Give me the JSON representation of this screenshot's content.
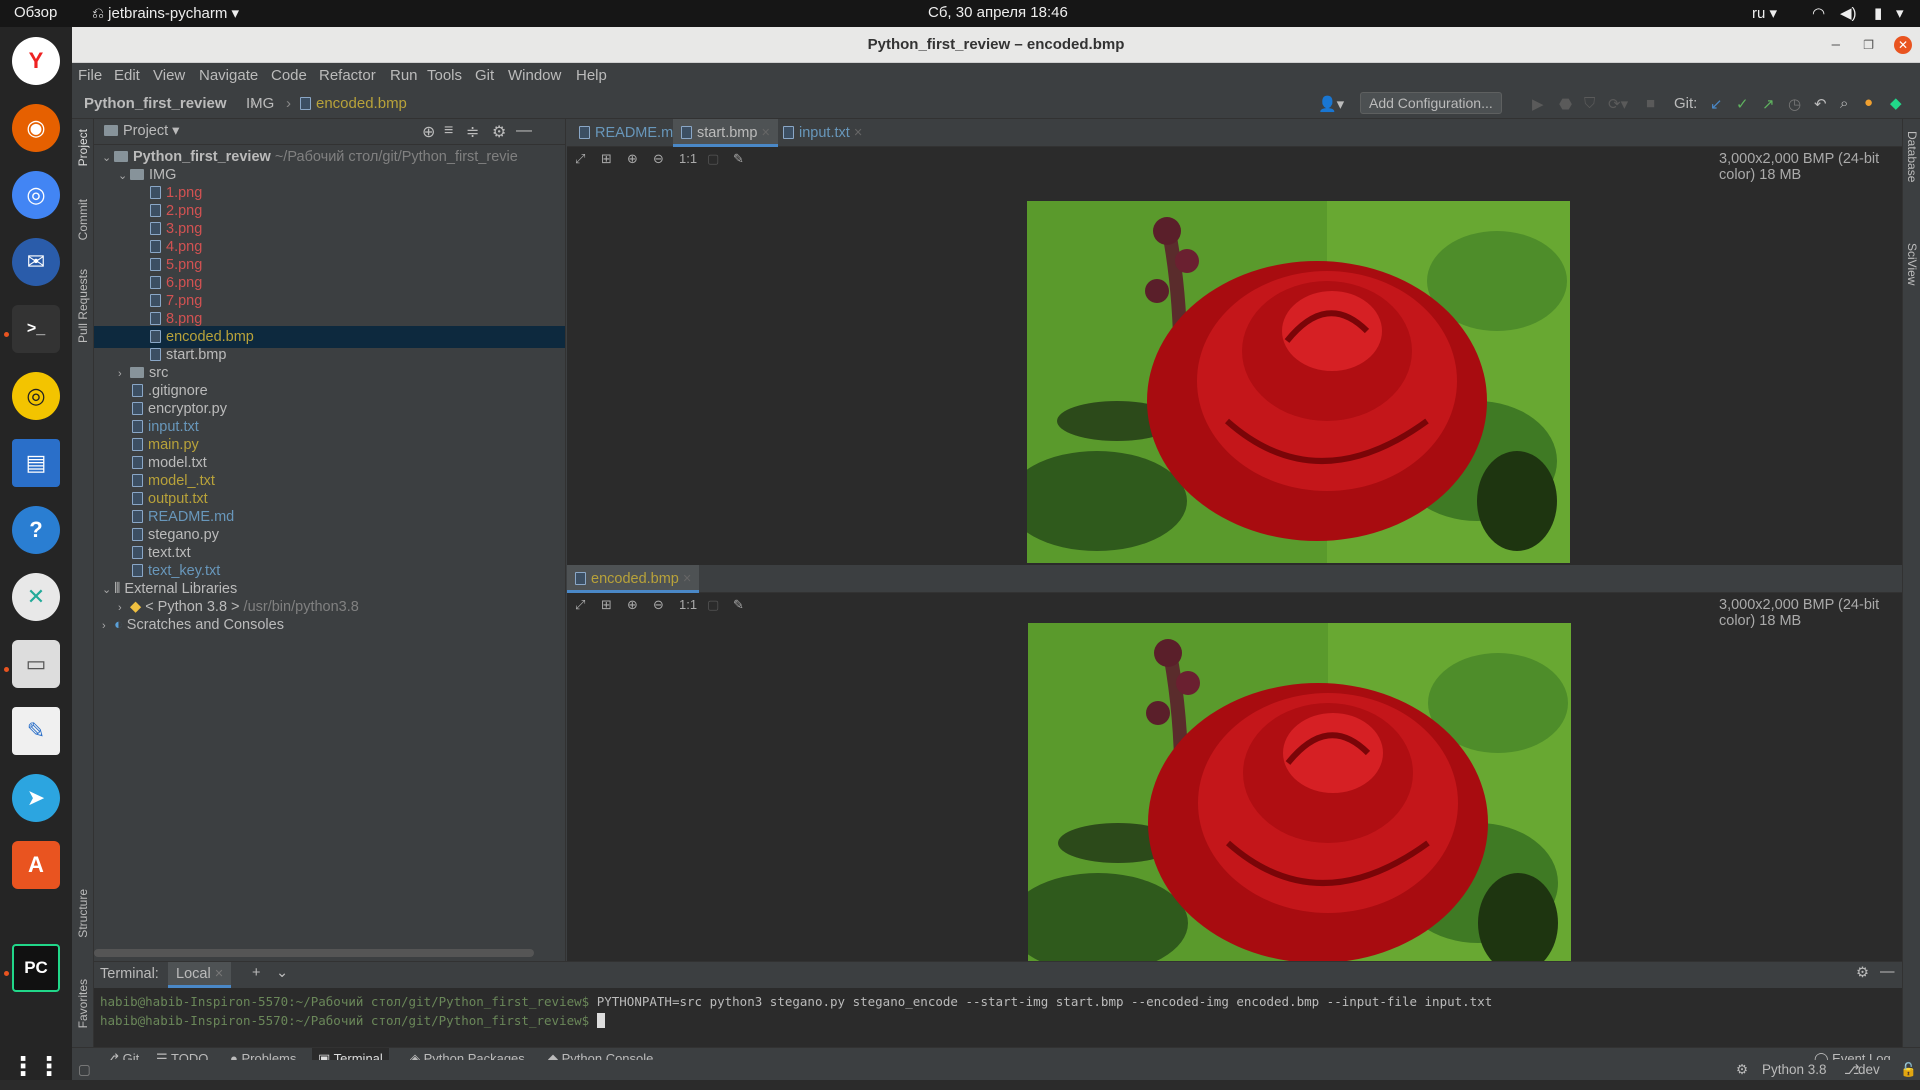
{
  "system": {
    "overview": "Обзор",
    "app_menu": "jetbrains-pycharm ▾",
    "datetime": "Сб, 30 апреля  18:46",
    "lang": "ru ▾"
  },
  "window": {
    "title": "Python_first_review – encoded.bmp"
  },
  "menu": [
    "File",
    "Edit",
    "View",
    "Navigate",
    "Code",
    "Refactor",
    "Run",
    "Tools",
    "Git",
    "Window",
    "Help"
  ],
  "breadcrumb": {
    "project": "Python_first_review",
    "folder": "IMG",
    "file": "encoded.bmp"
  },
  "toolbar": {
    "add_config": "Add Configuration...",
    "git_label": "Git:"
  },
  "left_tools": [
    "Project",
    "Commit",
    "Pull Requests",
    "Structure",
    "Favorites"
  ],
  "right_tools": [
    "Database",
    "SciView"
  ],
  "project_panel": {
    "title": "Project ▾",
    "root": "Python_first_review",
    "root_path": "~/Рабочий стол/git/Python_first_revie",
    "img_folder": "IMG",
    "img_files": [
      "1.png",
      "2.png",
      "3.png",
      "4.png",
      "5.png",
      "6.png",
      "7.png",
      "8.png"
    ],
    "encoded": "encoded.bmp",
    "start": "start.bmp",
    "src": "src",
    "files": [
      {
        "name": ".gitignore",
        "cls": "wht"
      },
      {
        "name": "encryptor.py",
        "cls": "wht"
      },
      {
        "name": "input.txt",
        "cls": "blu"
      },
      {
        "name": "main.py",
        "cls": "yel"
      },
      {
        "name": "model.txt",
        "cls": "wht"
      },
      {
        "name": "model_.txt",
        "cls": "yel"
      },
      {
        "name": "output.txt",
        "cls": "yel"
      },
      {
        "name": "README.md",
        "cls": "blu"
      },
      {
        "name": "stegano.py",
        "cls": "wht"
      },
      {
        "name": "text.txt",
        "cls": "wht"
      },
      {
        "name": "text_key.txt",
        "cls": "blu"
      }
    ],
    "ext_libs": "External Libraries",
    "python": "< Python 3.8 >",
    "python_path": "/usr/bin/python3.8",
    "scratches": "Scratches and Consoles"
  },
  "editor": {
    "tabs": [
      "README.md",
      "start.bmp",
      "input.txt"
    ],
    "bottom_tab": "encoded.bmp",
    "zoom_label": "1:1",
    "image_info": "3,000x2,000 BMP (24-bit color) 18 MB"
  },
  "terminal": {
    "label": "Terminal:",
    "tab": "Local",
    "line1_prompt": "habib@habib-Inspiron-5570:~/Рабочий стол/git/Python_first_review$",
    "line1_cmd": " PYTHONPATH=src python3 stegano.py stegano_encode --start-img start.bmp --encoded-img encoded.bmp --input-file input.txt",
    "line2_prompt": "habib@habib-Inspiron-5570:~/Рабочий стол/git/Python_first_review$"
  },
  "bottom_tools": [
    "Git",
    "TODO",
    "Problems",
    "Terminal",
    "Python Packages",
    "Python Console"
  ],
  "event_log": "Event Log",
  "status": {
    "interpreter": "Python 3.8",
    "branch": "dev"
  }
}
